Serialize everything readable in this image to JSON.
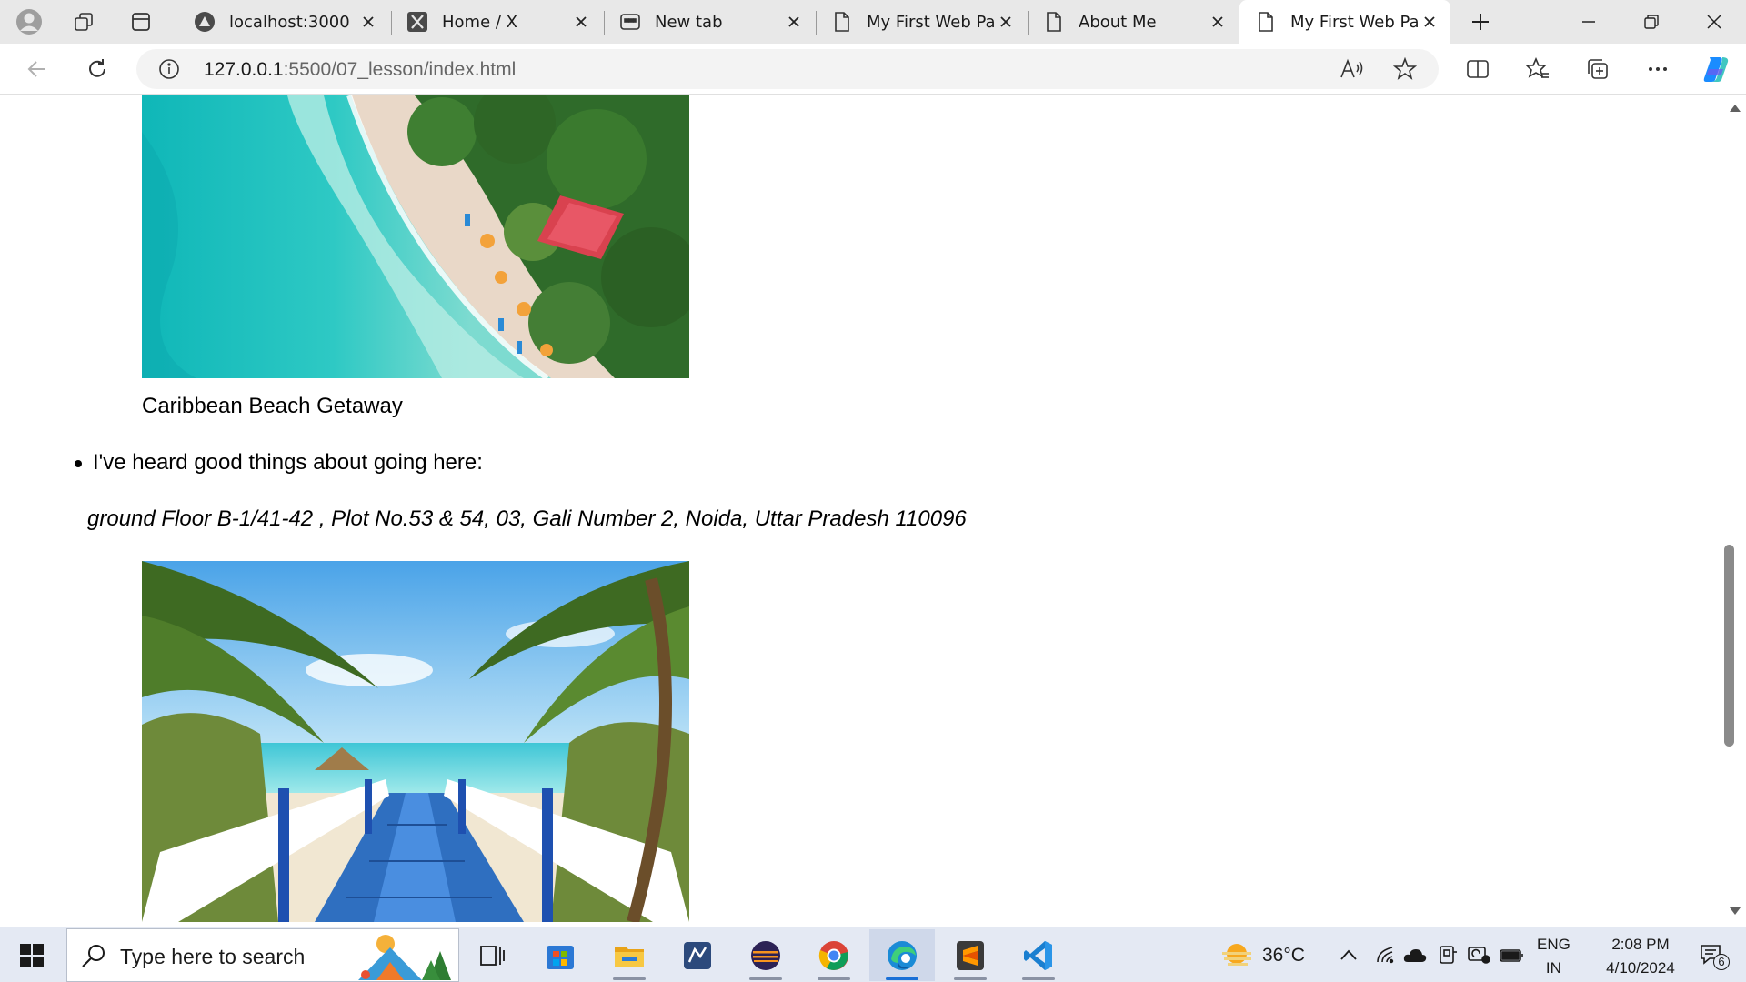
{
  "browser": {
    "tabs": [
      {
        "title": "localhost:3000",
        "icon": "triangle-site-icon"
      },
      {
        "title": "Home / X",
        "icon": "x-logo-icon"
      },
      {
        "title": "New tab",
        "icon": "new-tab-page-icon"
      },
      {
        "title": "My First Web Pag",
        "icon": "page-icon"
      },
      {
        "title": "About Me",
        "icon": "page-icon"
      },
      {
        "title": "My First Web Pag",
        "icon": "page-icon",
        "active": true
      }
    ],
    "address": {
      "host": "127.0.0.1",
      "rest": ":5500/07_lesson/index.html"
    }
  },
  "page": {
    "caption": "Caribbean Beach Getaway",
    "list_item": "I've heard good things about going here:",
    "address_line": "ground Floor B-1/41-42 , Plot No.53 & 54, 03, Gali Number 2, Noida, Uttar Pradesh 110096"
  },
  "taskbar": {
    "search_placeholder": "Type here to search",
    "apps": [
      "task-view",
      "microsoft-store",
      "file-explorer",
      "remote-app",
      "eclipse",
      "chrome",
      "edge",
      "sublime-text",
      "vs-code"
    ],
    "temperature": "36°C",
    "language": "ENG",
    "region": "IN",
    "time": "2:08 PM",
    "date": "4/10/2024",
    "notification_count": "6"
  },
  "colors": {
    "tab_strip": "#e8e8e8",
    "taskbar": "#e4e9f3",
    "edge_accent": "#1a6fd6"
  }
}
